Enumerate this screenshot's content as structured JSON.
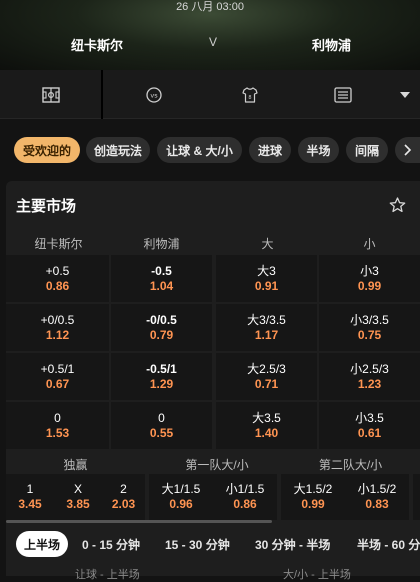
{
  "match": {
    "date": "26 八月 03:00",
    "home": "纽卡斯尔",
    "vs": "V",
    "away": "利物浦"
  },
  "nav_tabs": [
    {
      "icon": "pitch-icon"
    },
    {
      "icon": "versus-icon"
    },
    {
      "icon": "jersey-icon"
    },
    {
      "icon": "scoreboard-icon"
    },
    {
      "icon": "dropdown-arrow-icon"
    }
  ],
  "filter_chips": [
    "受欢迎的",
    "创造玩法",
    "让球 & 大/小",
    "进球",
    "半场",
    "间隔"
  ],
  "panel": {
    "title": "主要市场",
    "headers": [
      "纽卡斯尔",
      "利物浦",
      "大",
      "小"
    ],
    "rows": [
      {
        "home_line": "+0.5",
        "home_odds": "0.86",
        "away_line": "-0.5",
        "away_odds": "1.04",
        "over_line": "大3",
        "over_odds": "0.91",
        "under_line": "小3",
        "under_odds": "0.99"
      },
      {
        "home_line": "+0/0.5",
        "home_odds": "1.12",
        "away_line": "-0/0.5",
        "away_odds": "0.79",
        "over_line": "大3/3.5",
        "over_odds": "1.17",
        "under_line": "小3/3.5",
        "under_odds": "0.75"
      },
      {
        "home_line": "+0.5/1",
        "home_odds": "0.67",
        "away_line": "-0.5/1",
        "away_odds": "1.29",
        "over_line": "大2.5/3",
        "over_odds": "0.71",
        "under_line": "小2.5/3",
        "under_odds": "1.23"
      },
      {
        "home_line": "0",
        "home_odds": "1.53",
        "away_line": "0",
        "away_odds": "0.55",
        "over_line": "大3.5",
        "over_odds": "1.40",
        "under_line": "小3.5",
        "under_odds": "0.61"
      }
    ],
    "markets": [
      {
        "title": "独赢",
        "items": [
          {
            "label": "1",
            "odds": "3.45"
          },
          {
            "label": "X",
            "odds": "3.85"
          },
          {
            "label": "2",
            "odds": "2.03"
          }
        ]
      },
      {
        "title": "第一队大/小",
        "items": [
          {
            "label": "大1/1.5",
            "odds": "0.96"
          },
          {
            "label": "小1/1.5",
            "odds": "0.86"
          }
        ]
      },
      {
        "title": "第二队大/小",
        "items": [
          {
            "label": "大1.5/2",
            "odds": "0.99"
          },
          {
            "label": "小1.5/2",
            "odds": "0.83"
          }
        ]
      }
    ]
  },
  "period_tabs": [
    "上半场",
    "0 - 15 分钟",
    "15 - 30 分钟",
    "30 分钟 - 半场",
    "半场 - 60 分"
  ],
  "footer": [
    "让球 - 上半场",
    "大/小 - 上半场"
  ],
  "colors": {
    "accent": "#f2b66a",
    "odds": "#ff9452",
    "bg": "#131313",
    "panel": "#1e1e1e"
  }
}
